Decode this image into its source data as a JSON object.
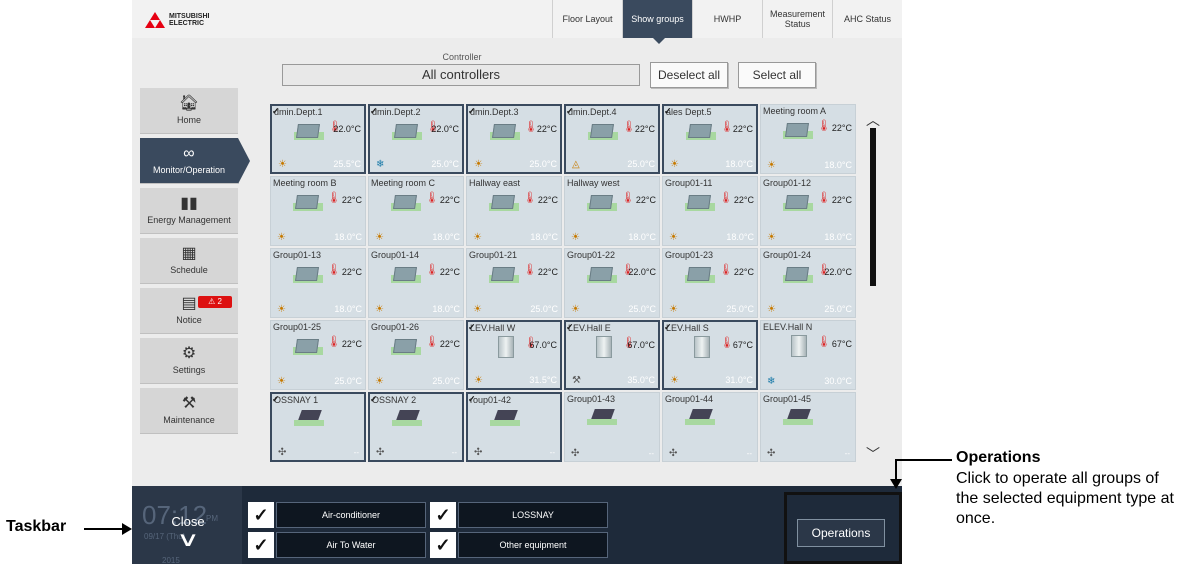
{
  "brand": {
    "logo_text_line1": "MITSUBISHI",
    "logo_text_line2": "ELECTRIC",
    "logo_color": "#e60012"
  },
  "tabs": [
    {
      "label": "Floor Layout",
      "active": false
    },
    {
      "label": "Show groups",
      "active": true
    },
    {
      "label": "HWHP",
      "active": false
    },
    {
      "label": "Measurement Status",
      "active": false
    },
    {
      "label": "AHC Status",
      "active": false
    }
  ],
  "controller": {
    "label": "Controller",
    "value": "All controllers",
    "deselect_label": "Deselect all",
    "select_label": "Select all"
  },
  "sidebar": [
    {
      "label": "Home",
      "icon": "home-icon",
      "glyph": "🏠︎",
      "active": false
    },
    {
      "label": "Monitor/Operation",
      "icon": "binoculars-icon",
      "glyph": "∞",
      "active": true
    },
    {
      "label": "Energy Management",
      "icon": "chart-icon",
      "glyph": "▮▮",
      "active": false
    },
    {
      "label": "Schedule",
      "icon": "calendar-icon",
      "glyph": "▦",
      "active": false
    },
    {
      "label": "Notice",
      "icon": "notice-icon",
      "glyph": "▤",
      "active": false,
      "badge": "⚠ 2"
    },
    {
      "label": "Settings",
      "icon": "gear-icon",
      "glyph": "⚙",
      "active": false
    },
    {
      "label": "Maintenance",
      "icon": "tools-icon",
      "glyph": "⚒",
      "active": false
    }
  ],
  "groups": [
    {
      "name": "Admin.Dept.1",
      "display": "dmin.Dept.1",
      "type": "ac",
      "selected": true,
      "set": "22.0°C",
      "room": "25.5°C",
      "mode": "heat"
    },
    {
      "name": "Admin.Dept.2",
      "display": "dmin.Dept.2",
      "type": "ac",
      "selected": true,
      "set": "22.0°C",
      "room": "25.0°C",
      "mode": "cool"
    },
    {
      "name": "Admin.Dept.3",
      "display": "dmin.Dept.3",
      "type": "ac",
      "selected": true,
      "set": "22°C",
      "room": "25.0°C",
      "mode": "heat"
    },
    {
      "name": "Admin.Dept.4",
      "display": "dmin.Dept.4",
      "type": "ac",
      "selected": true,
      "set": "22°C",
      "room": "25.0°C",
      "mode": "dry"
    },
    {
      "name": "Sales Dept.5",
      "display": "ales Dept.5",
      "type": "ac",
      "selected": true,
      "set": "22°C",
      "room": "18.0°C",
      "mode": "heat"
    },
    {
      "name": "Meeting room A",
      "display": "Meeting room A",
      "type": "ac",
      "selected": false,
      "set": "22°C",
      "room": "18.0°C",
      "mode": "heat"
    },
    {
      "name": "Meeting room B",
      "display": "Meeting room B",
      "type": "ac",
      "selected": false,
      "set": "22°C",
      "room": "18.0°C",
      "mode": "heat"
    },
    {
      "name": "Meeting room C",
      "display": "Meeting room C",
      "type": "ac",
      "selected": false,
      "set": "22°C",
      "room": "18.0°C",
      "mode": "heat"
    },
    {
      "name": "Hallway east",
      "display": "Hallway east",
      "type": "ac",
      "selected": false,
      "set": "22°C",
      "room": "18.0°C",
      "mode": "heat"
    },
    {
      "name": "Hallway west",
      "display": "Hallway west",
      "type": "ac",
      "selected": false,
      "set": "22°C",
      "room": "18.0°C",
      "mode": "heat"
    },
    {
      "name": "Group01-11",
      "display": "Group01-11",
      "type": "ac",
      "selected": false,
      "set": "22°C",
      "room": "18.0°C",
      "mode": "heat"
    },
    {
      "name": "Group01-12",
      "display": "Group01-12",
      "type": "ac",
      "selected": false,
      "set": "22°C",
      "room": "18.0°C",
      "mode": "heat"
    },
    {
      "name": "Group01-13",
      "display": "Group01-13",
      "type": "ac",
      "selected": false,
      "set": "22°C",
      "room": "18.0°C",
      "mode": "heat"
    },
    {
      "name": "Group01-14",
      "display": "Group01-14",
      "type": "ac",
      "selected": false,
      "set": "22°C",
      "room": "18.0°C",
      "mode": "heat"
    },
    {
      "name": "Group01-21",
      "display": "Group01-21",
      "type": "ac",
      "selected": false,
      "set": "22°C",
      "room": "25.0°C",
      "mode": "heat"
    },
    {
      "name": "Group01-22",
      "display": "Group01-22",
      "type": "ac",
      "selected": false,
      "set": "22.0°C",
      "room": "25.0°C",
      "mode": "heat"
    },
    {
      "name": "Group01-23",
      "display": "Group01-23",
      "type": "ac",
      "selected": false,
      "set": "22°C",
      "room": "25.0°C",
      "mode": "heat"
    },
    {
      "name": "Group01-24",
      "display": "Group01-24",
      "type": "ac",
      "selected": false,
      "set": "22.0°C",
      "room": "25.0°C",
      "mode": "heat"
    },
    {
      "name": "Group01-25",
      "display": "Group01-25",
      "type": "ac",
      "selected": false,
      "set": "22°C",
      "room": "25.0°C",
      "mode": "heat"
    },
    {
      "name": "Group01-26",
      "display": "Group01-26",
      "type": "ac",
      "selected": false,
      "set": "22°C",
      "room": "25.0°C",
      "mode": "heat"
    },
    {
      "name": "ELEV.Hall W",
      "display": "LEV.Hall W",
      "type": "water",
      "selected": true,
      "set": "67.0°C",
      "room": "31.5°C",
      "mode": "heat"
    },
    {
      "name": "ELEV.Hall E",
      "display": "LEV.Hall E",
      "type": "water",
      "selected": true,
      "set": "67.0°C",
      "room": "35.0°C",
      "mode": "fan"
    },
    {
      "name": "ELEV.Hall S",
      "display": "LEV.Hall S",
      "type": "water",
      "selected": true,
      "set": "67°C",
      "room": "31.0°C",
      "mode": "heat"
    },
    {
      "name": "ELEV.Hall N",
      "display": "ELEV.Hall N",
      "type": "water",
      "selected": false,
      "set": "67°C",
      "room": "30.0°C",
      "mode": "cool"
    },
    {
      "name": "LOSSNAY 1",
      "display": "OSSNAY 1",
      "type": "lossnay",
      "selected": true,
      "set": "",
      "room": "--",
      "mode": "fan"
    },
    {
      "name": "LOSSNAY 2",
      "display": "OSSNAY 2",
      "type": "lossnay",
      "selected": true,
      "set": "",
      "room": "--",
      "mode": "fan"
    },
    {
      "name": "Group01-42",
      "display": "roup01-42",
      "type": "lossnay",
      "selected": true,
      "set": "",
      "room": "--",
      "mode": "fan"
    },
    {
      "name": "Group01-43",
      "display": "Group01-43",
      "type": "lossnay",
      "selected": false,
      "set": "",
      "room": "--",
      "mode": "fan"
    },
    {
      "name": "Group01-44",
      "display": "Group01-44",
      "type": "lossnay",
      "selected": false,
      "set": "",
      "room": "--",
      "mode": "fan"
    },
    {
      "name": "Group01-45",
      "display": "Group01-45",
      "type": "lossnay",
      "selected": false,
      "set": "",
      "room": "--",
      "mode": "fan"
    }
  ],
  "taskbar": {
    "time": "07:12",
    "ampm": "PM",
    "date": "09/17 (Thu)",
    "year": "2015",
    "close_label": "Close",
    "equipment": [
      {
        "label": "Air-conditioner",
        "checked": true
      },
      {
        "label": "LOSSNAY",
        "checked": true
      },
      {
        "label": "Air To Water",
        "checked": true
      },
      {
        "label": "Other equipment",
        "checked": true
      }
    ],
    "operations_label": "Operations"
  },
  "annotations": {
    "taskbar_label": "Taskbar",
    "operations_title": "Operations",
    "operations_desc": "Click to operate all groups of the selected equipment type at once."
  },
  "colors": {
    "accent": "#3a4a5e",
    "cell_bg": "#d5dee4",
    "taskbar_bg": "#1e2a3a",
    "heat": "#c77a00",
    "cool": "#1a7aa8"
  }
}
